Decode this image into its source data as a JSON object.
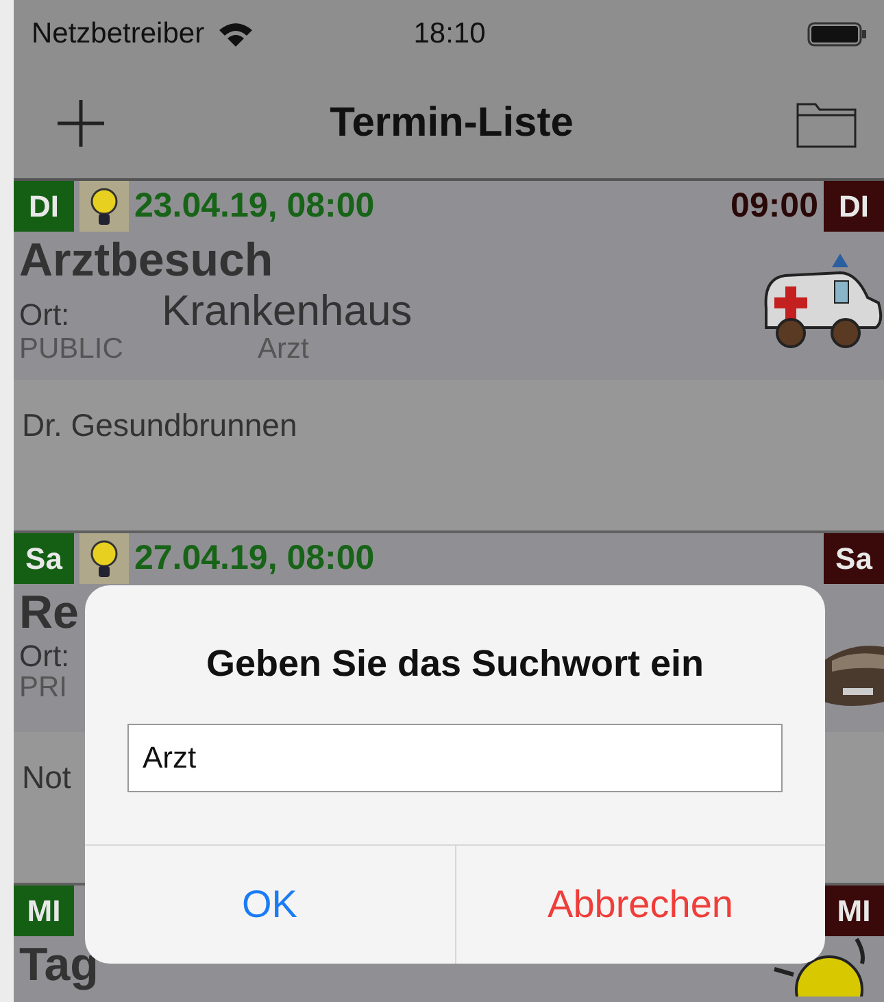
{
  "status_bar": {
    "carrier": "Netzbetreiber",
    "time": "18:10"
  },
  "nav": {
    "title": "Termin-Liste"
  },
  "appointments": [
    {
      "weekday": "DI",
      "reminder": true,
      "start": "23.04.19, 08:00",
      "end": "09:00",
      "weekday_end": "DI",
      "title": "Arztbesuch",
      "location_label": "Ort:",
      "location": "Krankenhaus",
      "visibility": "PUBLIC",
      "category": "Arzt",
      "note": "Dr. Gesundbrunnen",
      "kind": "ambulance"
    },
    {
      "weekday": "Sa",
      "reminder": true,
      "start": "27.04.19, 08:00",
      "weekday_end": "Sa",
      "title": "Re",
      "location_label": "Ort:",
      "visibility": "PRI",
      "note": "Not",
      "kind": "car"
    },
    {
      "weekday": "MI",
      "weekday_end": "MI",
      "title": "Tag",
      "kind": "sun"
    }
  ],
  "dialog": {
    "title": "Geben Sie das Suchwort ein",
    "field_value": "Arzt",
    "buttons": [
      {
        "label": "OK",
        "kind": "confirm"
      },
      {
        "label": "Abbrechen",
        "kind": "cancel"
      }
    ]
  }
}
